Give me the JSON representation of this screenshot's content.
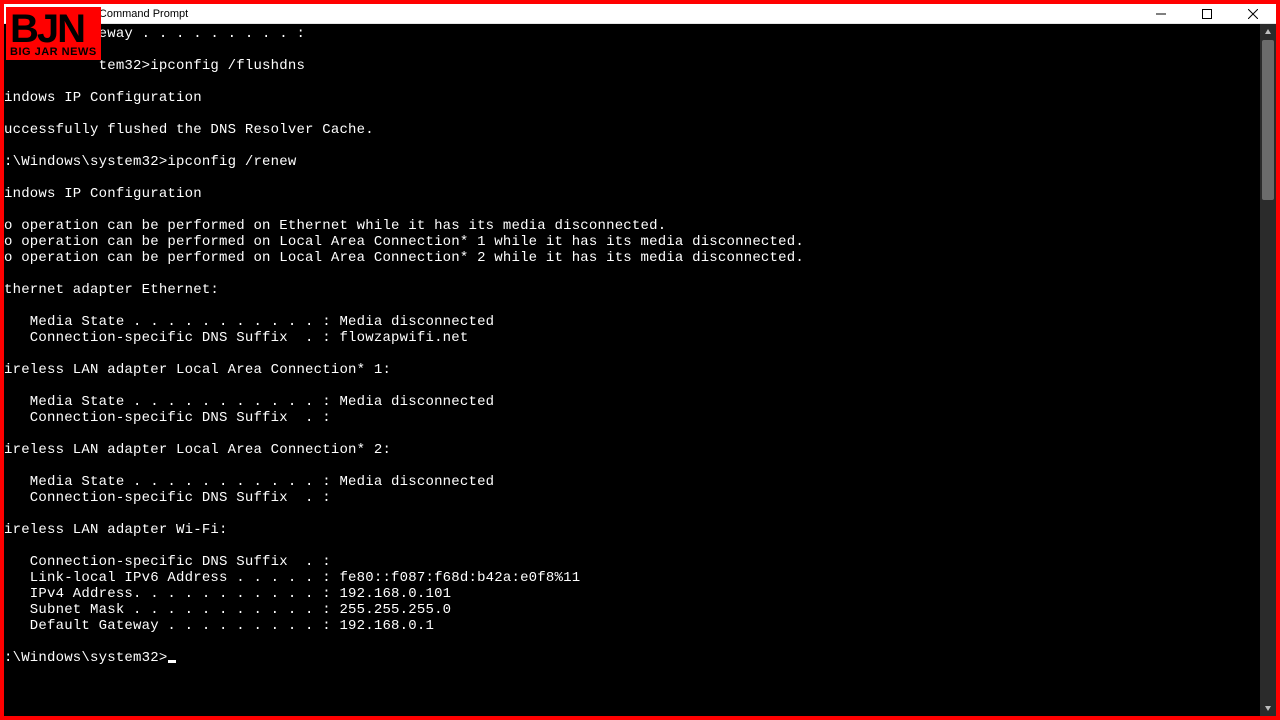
{
  "titlebar": {
    "title": "Administrator: Command Prompt"
  },
  "logo": {
    "abbr": "BJN",
    "full": "BIG JAR NEWS"
  },
  "terminal": {
    "lines": [
      "           eway . . . . . . . . . :",
      "",
      "           tem32>ipconfig /flushdns",
      "",
      "indows IP Configuration",
      "",
      "uccessfully flushed the DNS Resolver Cache.",
      "",
      ":\\Windows\\system32>ipconfig /renew",
      "",
      "indows IP Configuration",
      "",
      "o operation can be performed on Ethernet while it has its media disconnected.",
      "o operation can be performed on Local Area Connection* 1 while it has its media disconnected.",
      "o operation can be performed on Local Area Connection* 2 while it has its media disconnected.",
      "",
      "thernet adapter Ethernet:",
      "",
      "   Media State . . . . . . . . . . . : Media disconnected",
      "   Connection-specific DNS Suffix  . : flowzapwifi.net",
      "",
      "ireless LAN adapter Local Area Connection* 1:",
      "",
      "   Media State . . . . . . . . . . . : Media disconnected",
      "   Connection-specific DNS Suffix  . :",
      "",
      "ireless LAN adapter Local Area Connection* 2:",
      "",
      "   Media State . . . . . . . . . . . : Media disconnected",
      "   Connection-specific DNS Suffix  . :",
      "",
      "ireless LAN adapter Wi-Fi:",
      "",
      "   Connection-specific DNS Suffix  . :",
      "   Link-local IPv6 Address . . . . . : fe80::f087:f68d:b42a:e0f8%11",
      "   IPv4 Address. . . . . . . . . . . : 192.168.0.101",
      "   Subnet Mask . . . . . . . . . . . : 255.255.255.0",
      "   Default Gateway . . . . . . . . . : 192.168.0.1",
      "",
      ":\\Windows\\system32>"
    ]
  }
}
